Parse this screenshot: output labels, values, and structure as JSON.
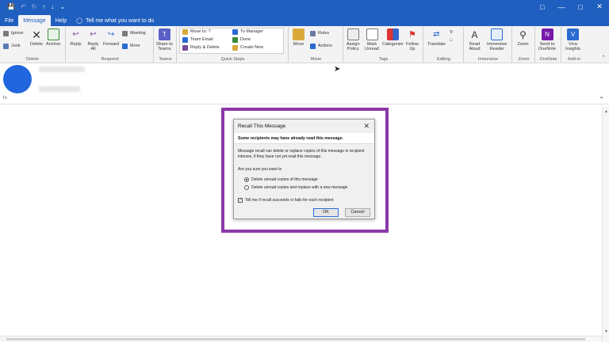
{
  "quick_access": {
    "save_icon": "save-icon",
    "undo_icon": "undo-icon",
    "redo_icon": "redo-icon",
    "up_icon": "up-arrow-icon",
    "down_icon": "down-arrow-icon",
    "more_icon": "chevron-down-icon"
  },
  "tabs": [
    {
      "label": "File"
    },
    {
      "label": "Message"
    },
    {
      "label": "Help"
    }
  ],
  "tell_me": {
    "placeholder": "Tell me what you want to do"
  },
  "ribbon": {
    "delete_group": {
      "label": "Delete",
      "ignore": "Ignore",
      "junk": "Junk",
      "delete": "Delete",
      "archive": "Archive"
    },
    "respond_group": {
      "label": "Respond",
      "reply": "Reply",
      "reply_all_1": "Reply",
      "reply_all_2": "All",
      "forward": "Forward",
      "meeting": "Meeting",
      "more": "More"
    },
    "teams_group": {
      "label": "Teams",
      "share_1": "Share to",
      "share_2": "Teams"
    },
    "quicksteps_group": {
      "label": "Quick Steps",
      "move_to": "Move to: ?",
      "team_email": "Team Email",
      "reply_delete": "Reply & Delete",
      "to_manager": "To Manager",
      "done": "Done",
      "create_new": "Create New"
    },
    "move_group": {
      "label": "Move",
      "move": "Move",
      "rules": "Rules",
      "actions": "Actions"
    },
    "tags_group": {
      "label": "Tags",
      "assign_1": "Assign",
      "assign_2": "Policy",
      "mark_1": "Mark",
      "mark_2": "Unread",
      "categorize": "Categorize",
      "follow_1": "Follow",
      "follow_2": "Up"
    },
    "editing_group": {
      "label": "Editing",
      "translate": "Translate"
    },
    "immersive_group": {
      "label": "Immersive",
      "read_1": "Read",
      "read_2": "Aloud",
      "reader_1": "Immersive",
      "reader_2": "Reader"
    },
    "zoom_group": {
      "label": "Zoom",
      "zoom": "Zoom"
    },
    "onenote_group": {
      "label": "OneNote",
      "send_1": "Send to",
      "send_2": "OneNote"
    },
    "addin_group": {
      "label": "Add-in",
      "viva_1": "Viva",
      "viva_2": "Insights"
    }
  },
  "header": {
    "to_label": "To"
  },
  "dialog": {
    "title": "Recall This Message",
    "warning": "Some recipients may have already read this message.",
    "description": "Message recall can delete or replace copies of this message in recipient inboxes, if they have not yet read this message.",
    "question": "Are you sure you want to",
    "option_delete": "Delete unread copies of this message",
    "option_replace": "Delete unread copies and replace with a new message",
    "selected_option": "delete",
    "notify_label": "Tell me if recall succeeds or fails for each recipient",
    "notify_checked": true,
    "ok_label": "OK",
    "cancel_label": "Cancel",
    "highlight_color": "#8a38a8"
  },
  "colors": {
    "accent": "#1f5fbf",
    "avatar": "#2266dd"
  }
}
